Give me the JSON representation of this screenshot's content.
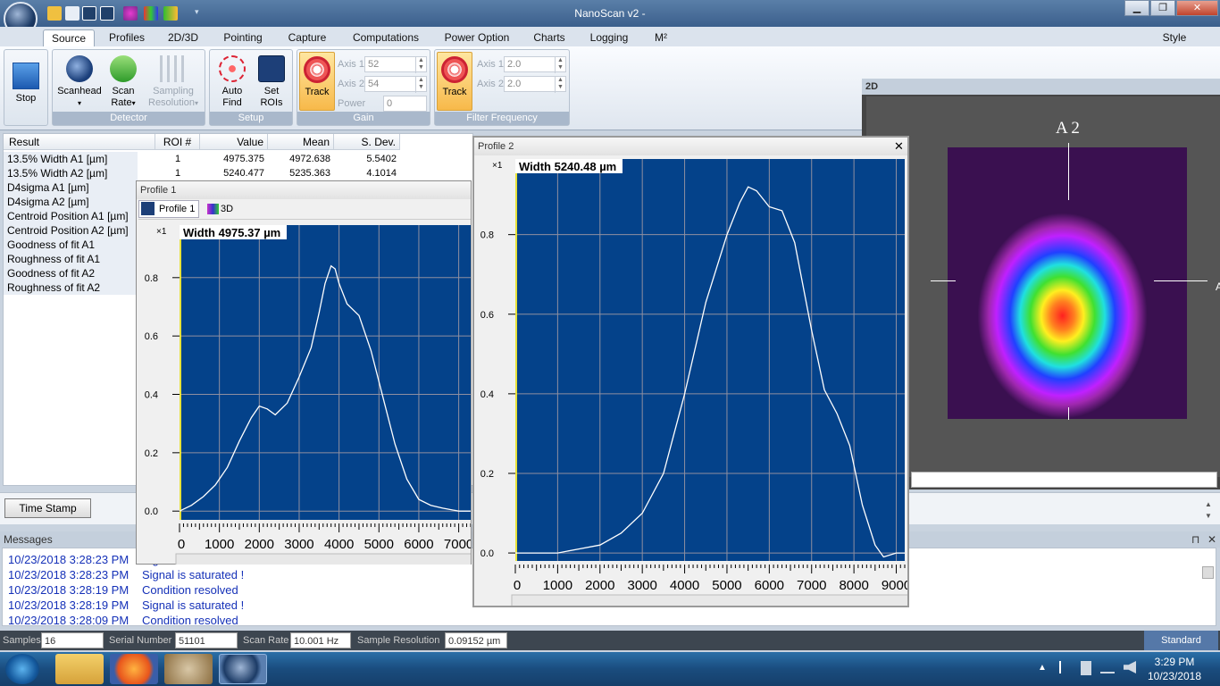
{
  "app": {
    "title": "NanoScan v2 -"
  },
  "window_buttons": {
    "minimize": "▁",
    "maximize": "❐",
    "close": "✕"
  },
  "tabs": [
    "Source",
    "Profiles",
    "2D/3D",
    "Pointing",
    "Capture",
    "Computations",
    "Power Option",
    "Charts",
    "Logging",
    "M²"
  ],
  "style_label": "Style",
  "ribbon": {
    "stop": "Stop",
    "scanhead": "Scanhead",
    "scan_rate_1": "Scan",
    "scan_rate_2": "Rate",
    "sampling_1": "Sampling",
    "sampling_2": "Resolution",
    "detector_group": "Detector",
    "auto_find_1": "Auto",
    "auto_find_2": "Find",
    "set_rois_1": "Set",
    "set_rois_2": "ROIs",
    "setup_group": "Setup",
    "gain_track": "Track",
    "gain_axis1_label": "Axis 1",
    "gain_axis1_value": "52",
    "gain_axis2_label": "Axis 2",
    "gain_axis2_value": "54",
    "power_label": "Power",
    "power_value": "0",
    "gain_group": "Gain",
    "ff_track": "Track",
    "ff_axis1_label": "Axis 1",
    "ff_axis1_value": "2.0",
    "ff_axis2_label": "Axis 2",
    "ff_axis2_value": "2.0",
    "ff_group": "Filter Frequency"
  },
  "results": {
    "headers": [
      "Result",
      "ROI #",
      "Value",
      "Mean",
      "S. Dev."
    ],
    "rows": [
      [
        "13.5% Width A1 [µm]",
        "1",
        "4975.375",
        "4972.638",
        "5.5402"
      ],
      [
        "13.5% Width A2 [µm]",
        "1",
        "5240.477",
        "5235.363",
        "4.1014"
      ],
      [
        "D4sigma A1 [µm]",
        "",
        "",
        "",
        ""
      ],
      [
        "D4sigma A2 [µm]",
        "",
        "",
        "",
        ""
      ],
      [
        "Centroid Position A1 [µm]",
        "",
        "",
        "",
        ""
      ],
      [
        "Centroid Position A2 [µm]",
        "",
        "",
        "",
        ""
      ],
      [
        "Goodness of fit A1",
        "",
        "",
        "",
        ""
      ],
      [
        "Roughness of fit A1",
        "",
        "",
        "",
        ""
      ],
      [
        "Goodness of fit A2",
        "",
        "",
        "",
        ""
      ],
      [
        "Roughness of fit A2",
        "",
        "",
        "",
        ""
      ]
    ]
  },
  "timestamp_button": "Time Stamp",
  "messages": {
    "title": "Messages",
    "pin": "⊓",
    "close": "✕",
    "items": [
      {
        "time": "10/23/2018 3:28:23 PM",
        "text": "Signal is saturated !"
      },
      {
        "time": "10/23/2018 3:28:23 PM",
        "text": "Signal is saturated !"
      },
      {
        "time": "10/23/2018 3:28:19 PM",
        "text": "Condition resolved"
      },
      {
        "time": "10/23/2018 3:28:19 PM",
        "text": "Signal is saturated !"
      },
      {
        "time": "10/23/2018 3:28:09 PM",
        "text": "Condition resolved"
      }
    ]
  },
  "status": {
    "samples_label": "Samples",
    "samples_value": "16",
    "serial_label": "Serial Number",
    "serial_value": "51101",
    "scanrate_label": "Scan Rate",
    "scanrate_value": "10.001 Hz",
    "sampleres_label": "Sample Resolution",
    "sampleres_value": "0.09152 µm",
    "mode": "Standard"
  },
  "panel2d": {
    "title": "2D",
    "axis_label": "A 2",
    "axis_right": "A"
  },
  "profile1": {
    "title": "Profile 1",
    "tab1": "Profile 1",
    "tab2": "3D",
    "scale": "×1",
    "width_label": "Width 4975.37 µm"
  },
  "profile2": {
    "title": "Profile 2",
    "close": "✕",
    "scale": "×1",
    "width_label": "Width 5240.48 µm"
  },
  "taskbar": {
    "time": "3:29 PM",
    "date": "10/23/2018"
  },
  "chart_data": [
    {
      "type": "line",
      "title": "Profile 1",
      "annotation": "Width 4975.37 µm",
      "x_ticks": [
        0,
        1000,
        2000,
        3000,
        4000,
        5000,
        6000,
        7000
      ],
      "y_ticks": [
        0.0,
        0.2,
        0.4,
        0.6,
        0.8
      ],
      "xlim": [
        0,
        7300
      ],
      "ylim": [
        -0.03,
        0.98
      ],
      "grid": true,
      "x": [
        0,
        300,
        600,
        900,
        1200,
        1500,
        1800,
        2000,
        2200,
        2400,
        2700,
        3000,
        3300,
        3500,
        3650,
        3800,
        3900,
        4000,
        4200,
        4500,
        4800,
        5100,
        5400,
        5700,
        6000,
        6300,
        6600,
        7000,
        7300
      ],
      "y": [
        0.0,
        0.02,
        0.05,
        0.09,
        0.15,
        0.24,
        0.32,
        0.36,
        0.35,
        0.33,
        0.37,
        0.46,
        0.56,
        0.68,
        0.78,
        0.84,
        0.83,
        0.78,
        0.71,
        0.67,
        0.55,
        0.39,
        0.23,
        0.11,
        0.04,
        0.02,
        0.01,
        0.0,
        0.0
      ]
    },
    {
      "type": "line",
      "title": "Profile 2",
      "annotation": "Width 5240.48 µm",
      "x_ticks": [
        0,
        1000,
        2000,
        3000,
        4000,
        5000,
        6000,
        7000,
        8000,
        9000
      ],
      "y_ticks": [
        0.0,
        0.2,
        0.4,
        0.6,
        0.8
      ],
      "xlim": [
        0,
        9200
      ],
      "ylim": [
        -0.02,
        0.99
      ],
      "grid": true,
      "x": [
        0,
        1000,
        1500,
        2000,
        2500,
        3000,
        3500,
        4000,
        4500,
        5000,
        5300,
        5500,
        5700,
        6000,
        6300,
        6600,
        7000,
        7300,
        7600,
        7900,
        8200,
        8500,
        8700,
        9000,
        9200
      ],
      "y": [
        0.0,
        0.0,
        0.01,
        0.02,
        0.05,
        0.1,
        0.2,
        0.4,
        0.63,
        0.8,
        0.88,
        0.92,
        0.91,
        0.87,
        0.86,
        0.78,
        0.56,
        0.41,
        0.35,
        0.27,
        0.12,
        0.02,
        -0.01,
        0.0,
        0.0
      ]
    }
  ]
}
